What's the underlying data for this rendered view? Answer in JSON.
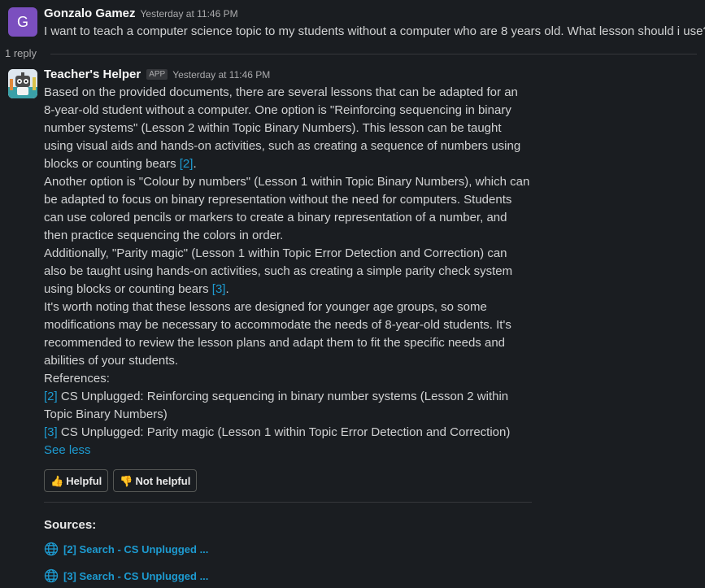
{
  "message1": {
    "avatar_letter": "G",
    "author": "Gonzalo Gamez",
    "time": "Yesterday at 11:46 PM",
    "text": "I want to teach a computer science topic to my students without a computer who are 8 years old. What lesson should i use?"
  },
  "thread": {
    "reply_count": "1 reply"
  },
  "message2": {
    "author": "Teacher's Helper",
    "badge": "APP",
    "time": "Yesterday at 11:46 PM",
    "p1": "Based on the provided documents, there are several lessons that can be adapted for an 8-year-old student without a computer. One option is \"Reinforcing sequencing in binary number systems\" (Lesson 2 within Topic Binary Numbers). This lesson can be taught using visual aids and hands-on activities, such as creating a sequence of numbers using blocks or counting bears",
    "p1_ref": "[2]",
    "p2": "Another option is \"Colour by numbers\" (Lesson 1 within Topic Binary Numbers), which can be adapted to focus on binary representation without the need for computers. Students can use colored pencils or markers to create a binary representation of a number, and then practice sequencing the colors in order.",
    "p3": "Additionally, \"Parity magic\" (Lesson 1 within Topic Error Detection and Correction) can also be taught using hands-on activities, such as creating a simple parity check system using blocks or counting bears",
    "p3_ref": "[3]",
    "p4": "It's worth noting that these lessons are designed for younger age groups, so some modifications may be necessary to accommodate the needs of 8-year-old students. It's recommended to review the lesson plans and adapt them to fit the specific needs and abilities of your students.",
    "references_label": "References:",
    "ref1_tag": "[2]",
    "ref1_text": "CS Unplugged: Reinforcing sequencing in binary number systems (Lesson 2 within Topic Binary Numbers)",
    "ref2_tag": "[3]",
    "ref2_text": "CS Unplugged: Parity magic (Lesson 1 within Topic Error Detection and Correction)",
    "see_less": "See less"
  },
  "feedback": {
    "helpful_emoji": "👍",
    "helpful_label": "Helpful",
    "not_helpful_emoji": "👎",
    "not_helpful_label": "Not helpful"
  },
  "sources": {
    "title": "Sources:",
    "items": [
      {
        "label": "[2] Search - CS Unplugged ...",
        "icon": "globe-icon"
      },
      {
        "label": "[3] Search - CS Unplugged ...",
        "icon": "globe-icon"
      }
    ]
  },
  "colors": {
    "link": "#1d9bd1",
    "background": "#1a1d21",
    "avatar": "#7b4fbf"
  }
}
